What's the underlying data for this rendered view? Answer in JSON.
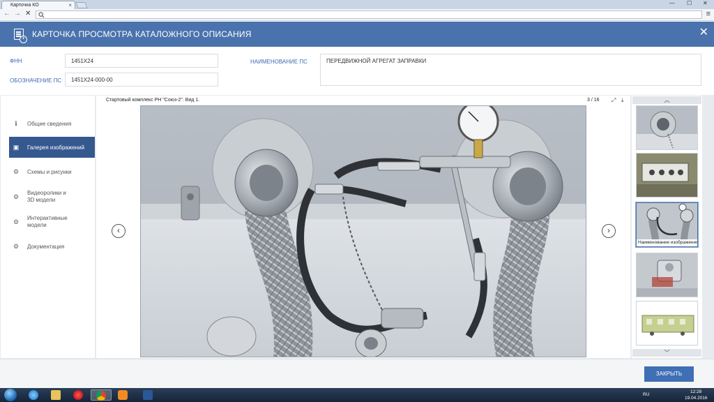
{
  "browser": {
    "tab_title": "Карточка КО",
    "tab_close": "×",
    "win_min": "—",
    "win_max": "☐",
    "win_close": "✕",
    "nav_back": "←",
    "nav_forward": "→",
    "nav_stop": "✕",
    "menu_glyph": "≡"
  },
  "header": {
    "title": "КАРТОЧКА ПРОСМОТРА КАТАЛОЖНОГО ОПИСАНИЯ",
    "close_glyph": "✕"
  },
  "fields": {
    "fnn_label": "ФНН",
    "fnn_value": "1451Х24",
    "designation_label": "ОБОЗНАЧЕНИЕ ПС",
    "designation_value": "1451Х24-000-00",
    "name_label": "НАИМЕНОВАНИЕ ПС",
    "name_value": "ПЕРЕДВИЖНОЙ АГРЕГАТ ЗАПРАВКИ"
  },
  "sidebar": {
    "items": [
      {
        "label": "Общие сведения",
        "icon": "info-icon",
        "glyph": "ℹ"
      },
      {
        "label": "Галерея изображений",
        "icon": "gallery-icon",
        "glyph": "▣"
      },
      {
        "label": "Схемы и рисунки",
        "icon": "diagram-icon",
        "glyph": "⚙"
      },
      {
        "label": "Видеоролики и\n3D модели",
        "icon": "video-icon",
        "glyph": "⚙"
      },
      {
        "label": "Интерактивные\nмодели",
        "icon": "interactive-icon",
        "glyph": "⚙"
      },
      {
        "label": "Документация",
        "icon": "document-icon",
        "glyph": "⚙"
      }
    ],
    "active_index": 1
  },
  "viewer": {
    "caption": "Стартовый комплекс РН \"Союз-2\". Вид 1.",
    "counter": "3 / 16",
    "prev_glyph": "‹",
    "next_glyph": "›",
    "fullscreen_glyph": "⤢",
    "download_glyph": "⤓"
  },
  "thumbnails": {
    "up_glyph": "︿",
    "down_glyph": "﹀",
    "selected_label": "Наименование изображения"
  },
  "footer": {
    "close_button": "ЗАКРЫТЬ"
  },
  "taskbar": {
    "lang": "RU",
    "time": "12:28",
    "date": "19.04.2016"
  }
}
